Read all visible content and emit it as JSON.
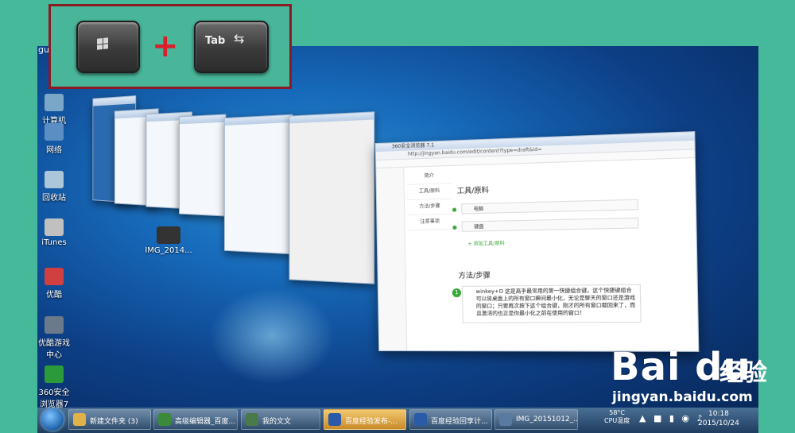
{
  "user_label": "guanjianle",
  "hotkey": {
    "win_key": "win-logo",
    "plus": "+",
    "tab_label": "Tab",
    "tab_arrows": "⇆"
  },
  "desktop_icons": [
    {
      "label": "计算机",
      "color": "#7aa6c8"
    },
    {
      "label": "网络",
      "color": "#5b8fc4"
    },
    {
      "label": "回收站",
      "color": "#aac6d8"
    },
    {
      "label": "iTunes",
      "color": "#c0c0c0"
    },
    {
      "label": "优酷",
      "color": "#d04040"
    },
    {
      "label": "优酷游戏中心",
      "color": "#6a7a8a"
    },
    {
      "label": "360安全浏览器7",
      "color": "#2a9a3a"
    }
  ],
  "desktop_file": "IMG_2014...",
  "baidu_window": {
    "title": "360安全浏览器 7.1",
    "url": "http://jingyan.baidu.com/edit/content?type=draft&id=",
    "nav": [
      "简介",
      "工具/原料",
      "方法/步骤",
      "注意事项"
    ],
    "section_tools": "工具/原料",
    "tools": [
      "电脑",
      "键盘"
    ],
    "add_tool": "+ 添加工具/原料",
    "section_steps": "方法/步骤",
    "step_number": "1",
    "step_text": "winkey+D 这是高手最常用的第一快捷组合键。这个快捷键组合可以将桌面上的所有窗口瞬间最小化，无论是聊天的窗口还是游戏的窗口；只要再次按下这个组合键，刚才的所有窗口都回来了，而且激活的也正是你最小化之前在使用的窗口！"
  },
  "taskbar": [
    {
      "label": "新建文件夹 (3)",
      "color": "#e2b24a",
      "active": false
    },
    {
      "label": "高级编辑器_百度...",
      "color": "#3a8a3a",
      "active": false
    },
    {
      "label": "我的文文",
      "color": "#4a7a4a",
      "active": false
    },
    {
      "label": "百度经验发布-...",
      "color": "#2a5aa8",
      "active": true
    },
    {
      "label": "百度经验回享计...",
      "color": "#2a5aa8",
      "active": false
    },
    {
      "label": "IMG_20151012_...",
      "color": "#5a7aa0",
      "active": false
    }
  ],
  "system": {
    "cpu_temp": "58°C",
    "cpu_label": "CPU温度",
    "time": "10:18",
    "date": "2015/10/24"
  },
  "watermark": {
    "brand": "Bai du",
    "cn": "经验",
    "url": "jingyan.baidu.com"
  }
}
